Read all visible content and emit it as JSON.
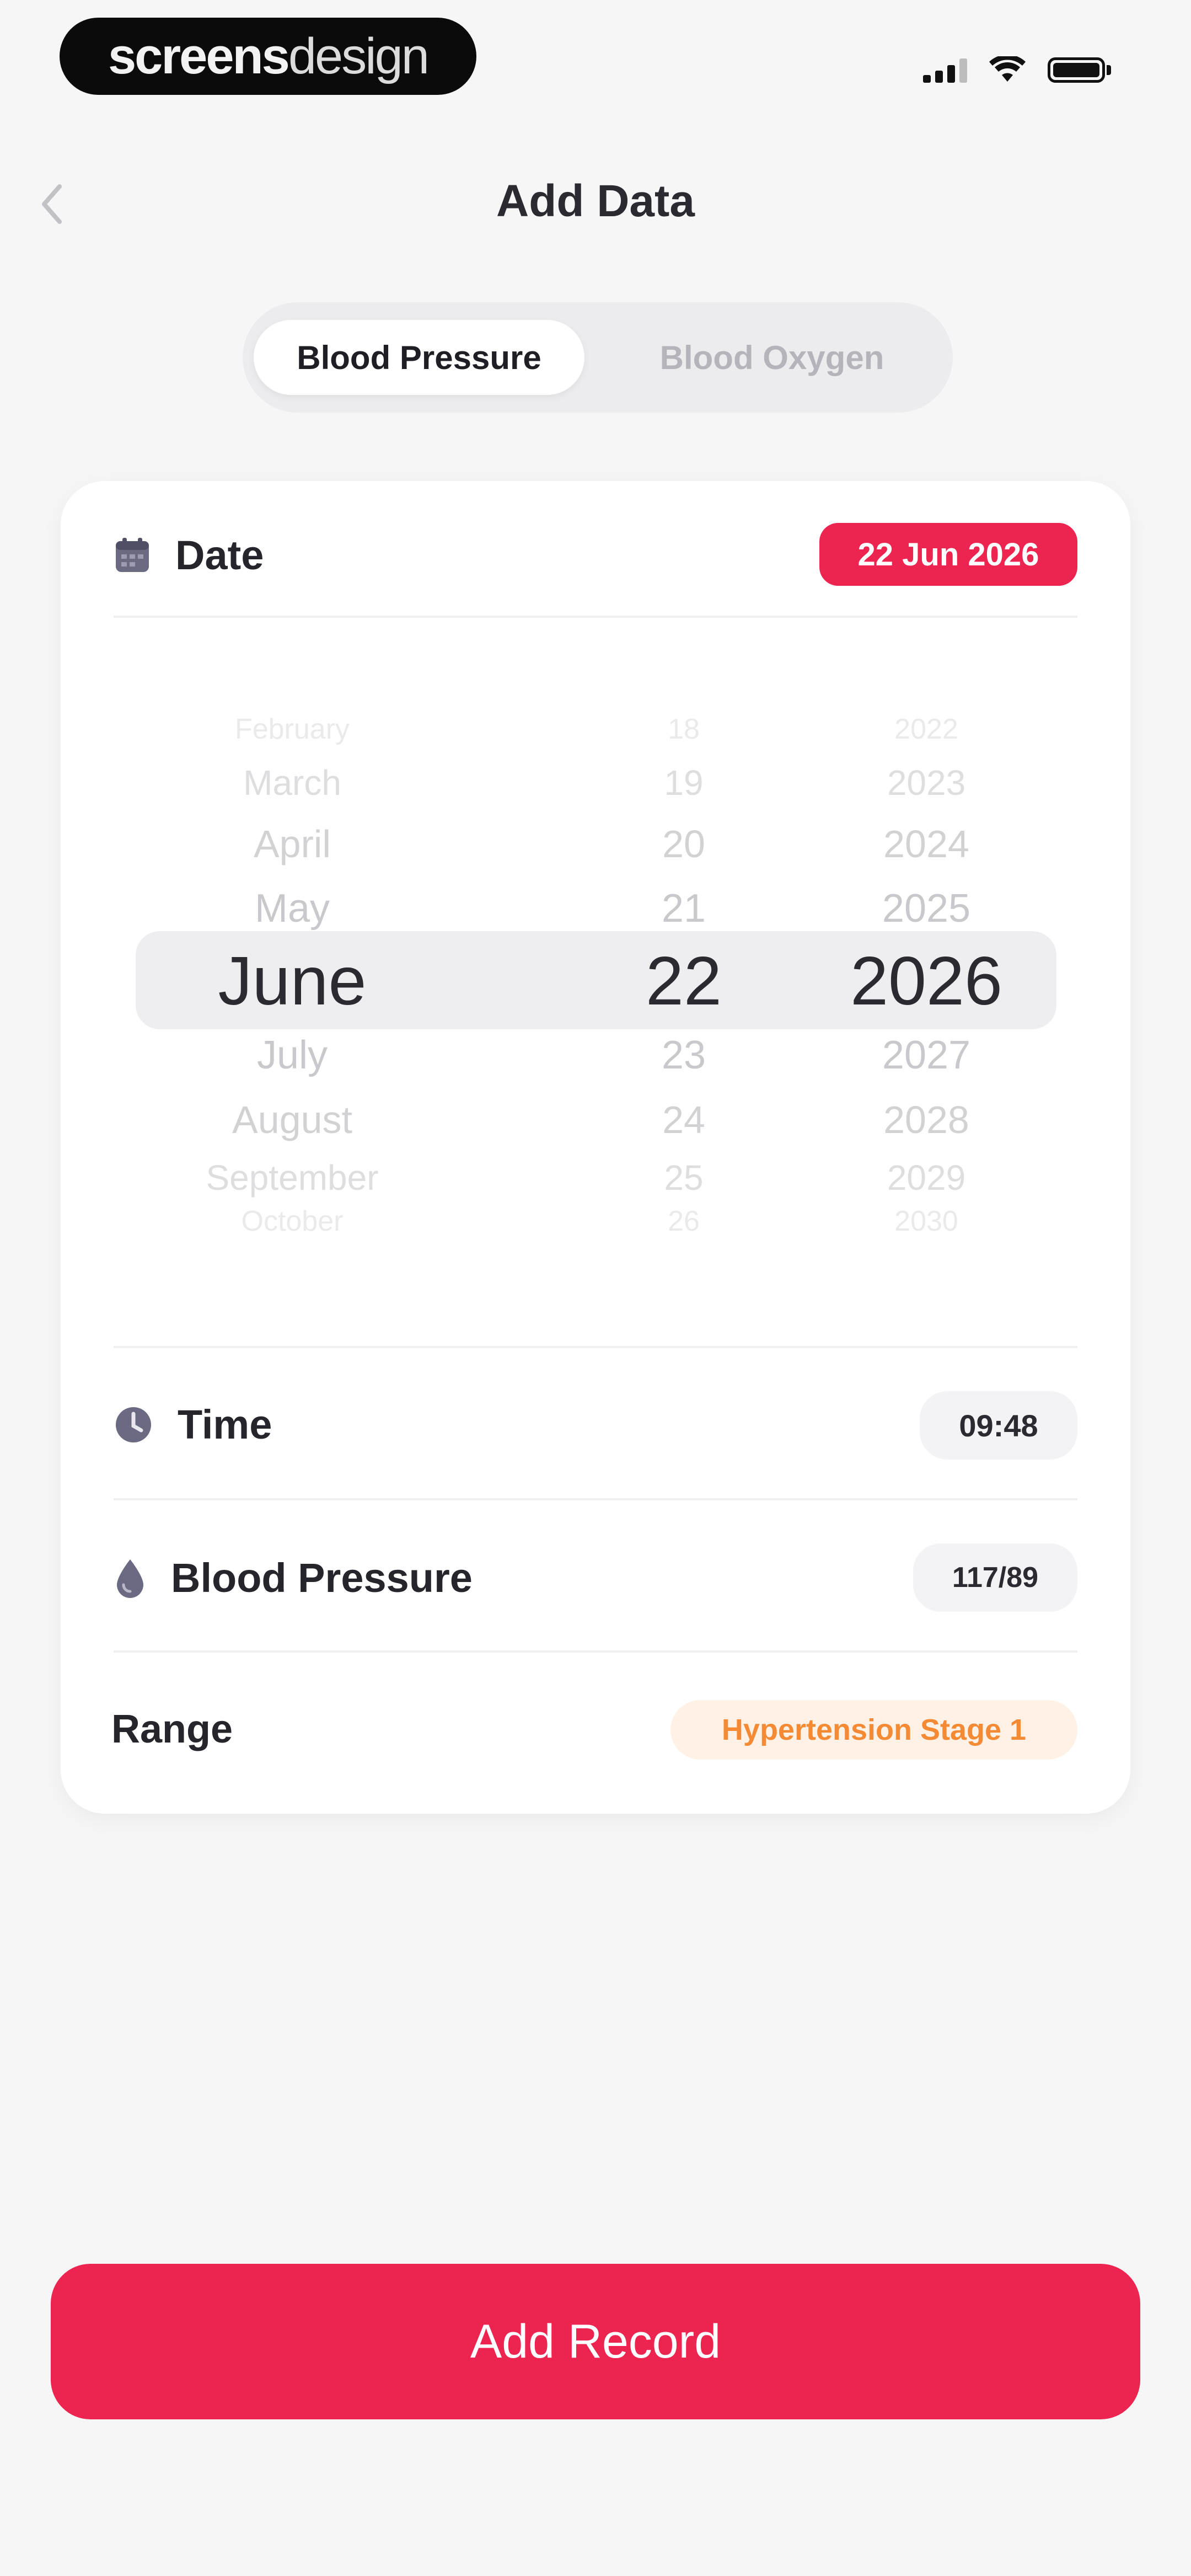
{
  "status_bar": {
    "brand_bold": "screens",
    "brand_light": "design",
    "icons": [
      "cellular-signal-icon",
      "wifi-icon",
      "battery-icon"
    ]
  },
  "header": {
    "title": "Add Data",
    "back_icon": "chevron-left-icon"
  },
  "tabs": {
    "active": "Blood Pressure",
    "inactive": "Blood Oxygen"
  },
  "date": {
    "label": "Date",
    "icon": "calendar-icon",
    "value": "22 Jun 2026"
  },
  "picker": {
    "months": [
      "February",
      "March",
      "April",
      "May",
      "June",
      "July",
      "August",
      "September",
      "October"
    ],
    "days": [
      "18",
      "19",
      "20",
      "21",
      "22",
      "23",
      "24",
      "25",
      "26"
    ],
    "years": [
      "2022",
      "2023",
      "2024",
      "2025",
      "2026",
      "2027",
      "2028",
      "2029",
      "2030"
    ],
    "selected_index": 4
  },
  "time": {
    "label": "Time",
    "icon": "clock-icon",
    "value": "09:48"
  },
  "blood_pressure": {
    "label": "Blood Pressure",
    "icon": "drop-icon",
    "value": "117/89"
  },
  "range": {
    "label": "Range",
    "value": "Hypertension Stage 1"
  },
  "action": {
    "label": "Add Record"
  },
  "colors": {
    "accent": "#ee2450",
    "range_text": "#f48a33",
    "range_bg": "#fff1e6",
    "icon": "#6a6a82"
  }
}
